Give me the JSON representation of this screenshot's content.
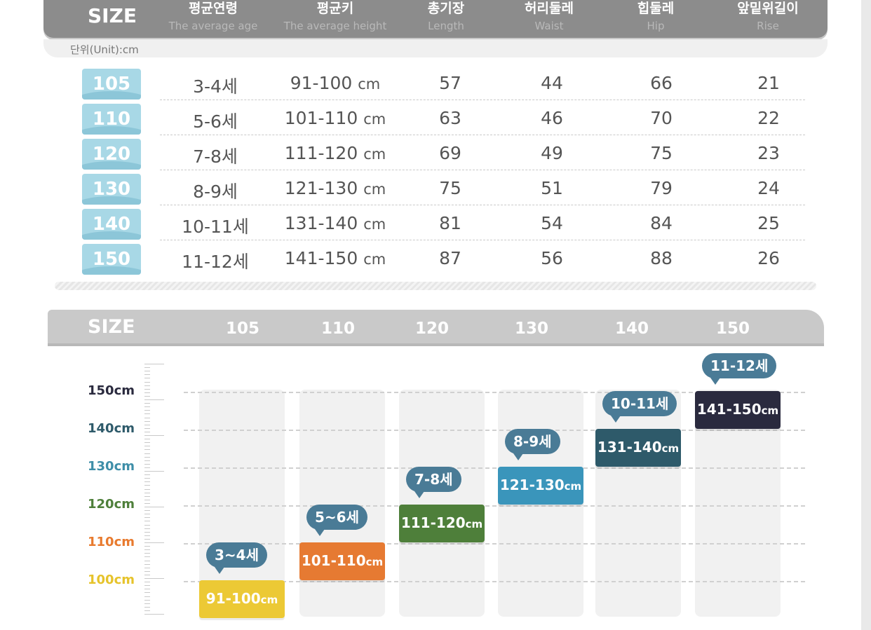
{
  "table": {
    "size_label": "SIZE",
    "columns": [
      {
        "ko": "평균연령",
        "en": "The average age"
      },
      {
        "ko": "평균키",
        "en": "The average height"
      },
      {
        "ko": "총기장",
        "en": "Length"
      },
      {
        "ko": "허리둘레",
        "en": "Waist"
      },
      {
        "ko": "힙둘레",
        "en": "Hip"
      },
      {
        "ko": "앞밑위길이",
        "en": "Rise"
      }
    ],
    "unit": "단위(Unit):cm",
    "rows": [
      {
        "size": "105",
        "age": "3-4세",
        "height": "91-100",
        "length": "57",
        "waist": "44",
        "hip": "66",
        "rise": "21"
      },
      {
        "size": "110",
        "age": "5-6세",
        "height": "101-110",
        "length": "63",
        "waist": "46",
        "hip": "70",
        "rise": "22"
      },
      {
        "size": "120",
        "age": "7-8세",
        "height": "111-120",
        "length": "69",
        "waist": "49",
        "hip": "75",
        "rise": "23"
      },
      {
        "size": "130",
        "age": "8-9세",
        "height": "121-130",
        "length": "75",
        "waist": "51",
        "hip": "79",
        "rise": "24"
      },
      {
        "size": "140",
        "age": "10-11세",
        "height": "131-140",
        "length": "81",
        "waist": "54",
        "hip": "84",
        "rise": "25"
      },
      {
        "size": "150",
        "age": "11-12세",
        "height": "141-150",
        "length": "87",
        "waist": "56",
        "hip": "88",
        "rise": "26"
      }
    ],
    "height_unit": "cm"
  },
  "chart_header": {
    "title": "SIZE",
    "sizes": [
      "105",
      "110",
      "120",
      "130",
      "140",
      "150"
    ]
  },
  "chart_data": {
    "type": "bar",
    "categories": [
      "105",
      "110",
      "120",
      "130",
      "140",
      "150"
    ],
    "y_ticks": [
      "100cm",
      "110cm",
      "120cm",
      "130cm",
      "140cm",
      "150cm"
    ],
    "y_tick_colors": [
      "#e6c32b",
      "#e87a2e",
      "#4e7f3a",
      "#3e8ea8",
      "#2e5a6a",
      "#2a2a3e"
    ],
    "ylim": [
      100,
      150
    ],
    "bars": [
      {
        "range": [
          91,
          100
        ],
        "label": "91-100",
        "unit": "cm",
        "age": "3~4세",
        "color": "#ecc935"
      },
      {
        "range": [
          101,
          110
        ],
        "label": "101-110",
        "unit": "cm",
        "age": "5~6세",
        "color": "#e67a32"
      },
      {
        "range": [
          111,
          120
        ],
        "label": "111-120",
        "unit": "cm",
        "age": "7-8세",
        "color": "#4e7f3a"
      },
      {
        "range": [
          121,
          130
        ],
        "label": "121-130",
        "unit": "cm",
        "age": "8-9세",
        "color": "#3a95bb"
      },
      {
        "range": [
          131,
          140
        ],
        "label": "131-140",
        "unit": "cm",
        "age": "10-11세",
        "color": "#2e5a6a"
      },
      {
        "range": [
          141,
          150
        ],
        "label": "141-150",
        "unit": "cm",
        "age": "11-12세",
        "color": "#2a2a3e"
      }
    ]
  }
}
